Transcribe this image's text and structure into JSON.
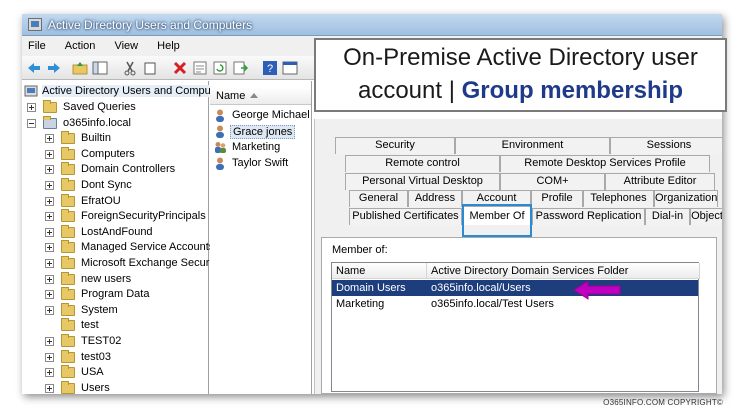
{
  "window": {
    "title": "Active Directory Users and Computers"
  },
  "menu": [
    "File",
    "Action",
    "View",
    "Help"
  ],
  "tree": {
    "root": "Active Directory Users and Comput",
    "items": [
      {
        "label": "Saved Queries",
        "level": 1,
        "expand": "plus",
        "icon": "folder-icon"
      },
      {
        "label": "o365info.local",
        "level": 1,
        "expand": "minus",
        "icon": "domain-icon"
      },
      {
        "label": "Builtin",
        "level": 2,
        "expand": "plus",
        "icon": "folder-icon"
      },
      {
        "label": "Computers",
        "level": 2,
        "expand": "plus",
        "icon": "folder-icon"
      },
      {
        "label": "Domain Controllers",
        "level": 2,
        "expand": "plus",
        "icon": "ou-icon"
      },
      {
        "label": "Dont Sync",
        "level": 2,
        "expand": "plus",
        "icon": "ou-icon"
      },
      {
        "label": "EfratOU",
        "level": 2,
        "expand": "plus",
        "icon": "ou-icon"
      },
      {
        "label": "ForeignSecurityPrincipals",
        "level": 2,
        "expand": "plus",
        "icon": "folder-icon"
      },
      {
        "label": "LostAndFound",
        "level": 2,
        "expand": "plus",
        "icon": "folder-icon"
      },
      {
        "label": "Managed Service Accounts",
        "level": 2,
        "expand": "plus",
        "icon": "folder-icon"
      },
      {
        "label": "Microsoft Exchange Securit",
        "level": 2,
        "expand": "plus",
        "icon": "ou-icon"
      },
      {
        "label": "new users",
        "level": 2,
        "expand": "plus",
        "icon": "ou-icon"
      },
      {
        "label": "Program Data",
        "level": 2,
        "expand": "plus",
        "icon": "folder-icon"
      },
      {
        "label": "System",
        "level": 2,
        "expand": "plus",
        "icon": "folder-icon"
      },
      {
        "label": "test",
        "level": 2,
        "expand": "none",
        "icon": "ou-icon"
      },
      {
        "label": "TEST02",
        "level": 2,
        "expand": "plus",
        "icon": "ou-icon"
      },
      {
        "label": "test03",
        "level": 2,
        "expand": "plus",
        "icon": "ou-icon"
      },
      {
        "label": "USA",
        "level": 2,
        "expand": "plus",
        "icon": "ou-icon"
      },
      {
        "label": "Users",
        "level": 2,
        "expand": "plus",
        "icon": "folder-icon"
      }
    ]
  },
  "list": {
    "column": "Name",
    "items": [
      {
        "label": "George Michael",
        "icon": "user-icon",
        "selected": false
      },
      {
        "label": "Grace jones",
        "icon": "user-icon",
        "selected": true
      },
      {
        "label": "Marketing",
        "icon": "group-icon",
        "selected": false
      },
      {
        "label": "Taylor Swift",
        "icon": "user-icon",
        "selected": false
      }
    ]
  },
  "dialog": {
    "tabs_row1": [
      "Security",
      "Environment",
      "Sessions"
    ],
    "tabs_row2": [
      "Remote control",
      "Remote Desktop Services Profile"
    ],
    "tabs_row3": [
      "Personal Virtual Desktop",
      "COM+",
      "Attribute Editor"
    ],
    "tabs_row4": [
      "General",
      "Address",
      "Account",
      "Profile",
      "Telephones",
      "Organization"
    ],
    "tabs_row5": [
      "Published Certificates",
      "Member Of",
      "Password Replication",
      "Dial-in",
      "Object"
    ],
    "active_tab": "Member Of",
    "member_of_label": "Member of:",
    "columns": [
      "Name",
      "Active Directory Domain Services Folder"
    ],
    "rows": [
      {
        "name": "Domain Users",
        "folder": "o365info.local/Users",
        "selected": true
      },
      {
        "name": "Marketing",
        "folder": "o365info.local/Test Users",
        "selected": false
      }
    ]
  },
  "callout": {
    "line1": "On-Premise Active Directory user",
    "line2_prefix": "account | ",
    "line2_bold": "Group membership",
    "border_color": "#7a7a7a",
    "accent": "#1f3a8a"
  },
  "highlight_color": "#2a8ad4",
  "arrow_color": "#c000c0",
  "copyright": "O365INFO.COM COPYRIGHT©"
}
